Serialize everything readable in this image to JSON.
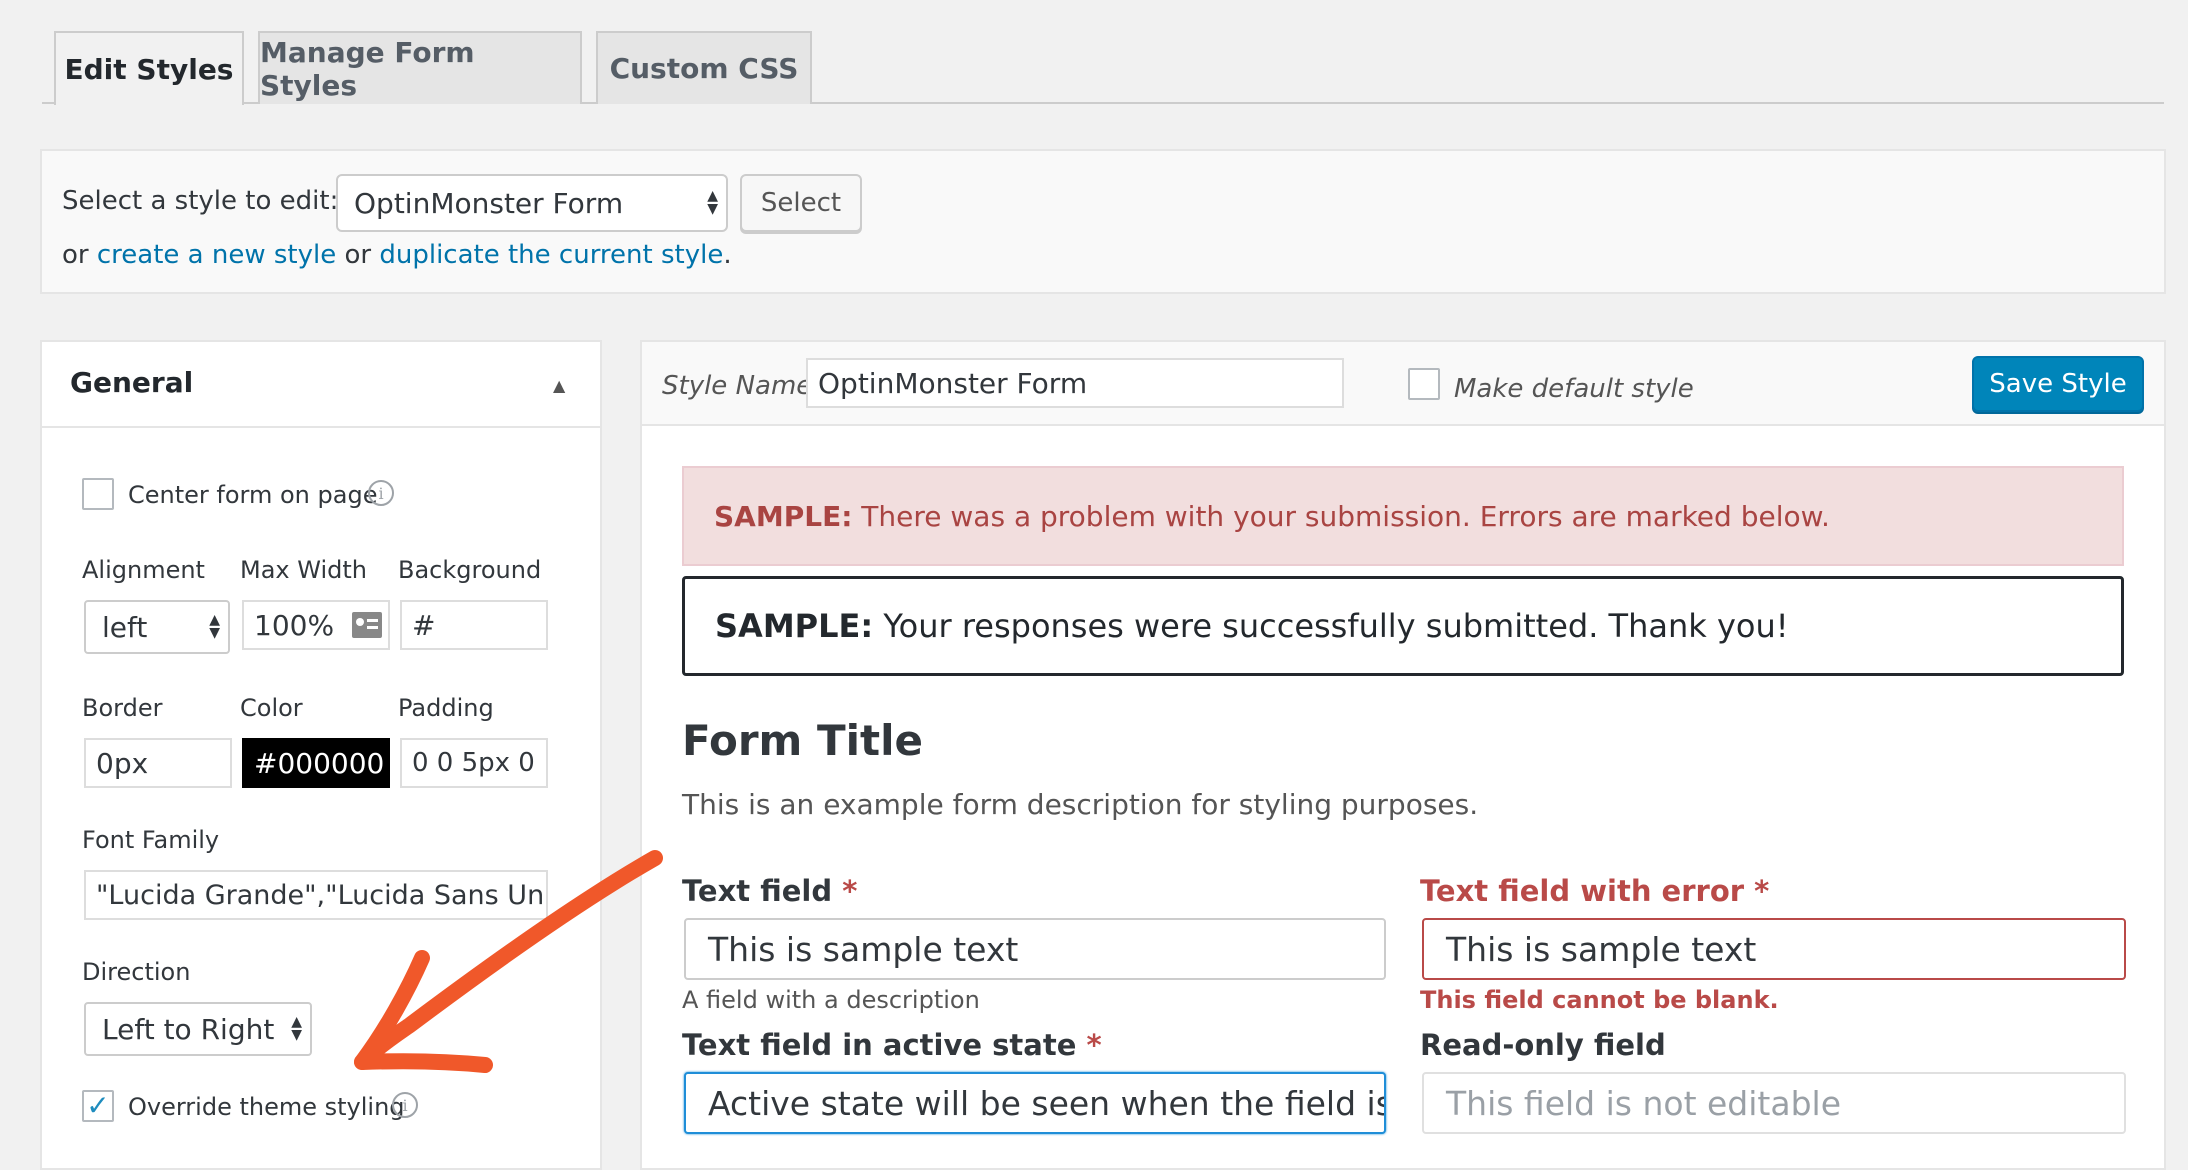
{
  "tabs": [
    {
      "label": "Edit Styles",
      "active": true
    },
    {
      "label": "Manage Form Styles",
      "active": false
    },
    {
      "label": "Custom CSS",
      "active": false
    }
  ],
  "style_selector": {
    "label": "Select a style to edit:",
    "selected": "OptinMonster Form",
    "select_button": "Select",
    "or1": "or",
    "create_link": "create a new style",
    "or2": "or",
    "duplicate_link": "duplicate the current style",
    "period": "."
  },
  "general": {
    "title": "General",
    "center_form_label": "Center form on page",
    "center_form_checked": false,
    "alignment_label": "Alignment",
    "alignment_value": "left",
    "max_width_label": "Max Width",
    "max_width_value": "100%",
    "background_label": "Background",
    "background_value": "#",
    "border_label": "Border",
    "border_value": "0px",
    "color_label": "Color",
    "color_value": "#000000",
    "padding_label": "Padding",
    "padding_value": "0 0 5px 0",
    "font_family_label": "Font Family",
    "font_family_value": "\"Lucida Grande\",\"Lucida Sans Uni",
    "direction_label": "Direction",
    "direction_value": "Left to Right",
    "override_label": "Override theme styling",
    "override_checked": true
  },
  "editor": {
    "style_name_label": "Style Name",
    "style_name_value": "OptinMonster Form",
    "make_default_label": "Make default style",
    "save_button": "Save Style"
  },
  "preview": {
    "error_prefix": "SAMPLE:",
    "error_message": "There was a problem with your submission. Errors are marked below.",
    "success_prefix": "SAMPLE:",
    "success_message": "Your responses were successfully submitted. Thank you!",
    "form_title": "Form Title",
    "form_description": "This is an example form description for styling purposes.",
    "text_field_label": "Text field",
    "text_field_value": "This is sample text",
    "text_field_description": "A field with a description",
    "error_field_label": "Text field with error",
    "error_field_value": "This is sample text",
    "error_field_message": "This field cannot be blank.",
    "active_field_label": "Text field in active state",
    "active_field_value": "Active state will be seen when the field is c",
    "readonly_field_label": "Read-only field",
    "readonly_field_value": "This field is not editable",
    "required_mark": "*"
  },
  "colors": {
    "accent": "#0085ba",
    "link": "#0073aa",
    "error": "#b94a48",
    "arrow": "#f0582a"
  }
}
